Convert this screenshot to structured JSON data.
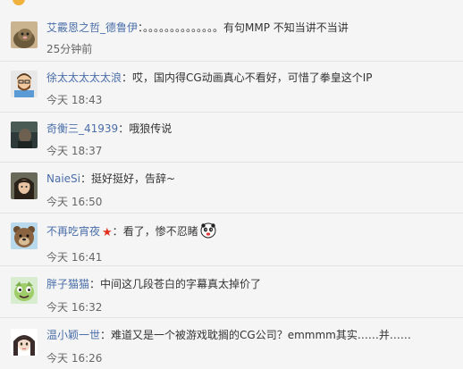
{
  "comments": [
    {
      "user": "艾霰恩之哲_德鲁伊",
      "sep": "：",
      "text": "。。。。。。。。。。。。。。有句MMP 不知当讲不当讲",
      "time": "25分钟前",
      "avatar": "mole-icon"
    },
    {
      "user": "徐太太太太太浪",
      "sep": "：",
      "text": "哎，国内得CG动画真心不看好，可惜了拳皇这个IP",
      "time": "今天 18:43",
      "avatar": "bearded-man-icon"
    },
    {
      "user": "奇衡三_41939",
      "sep": "：",
      "text": "哦狼传说",
      "time": "今天 18:37",
      "avatar": "dark-figure-icon"
    },
    {
      "user": "NaieSi",
      "sep": "：",
      "text": "挺好挺好，告辞~",
      "time": "今天 16:50",
      "avatar": "girl-portrait-icon"
    },
    {
      "user": "不再吃宵夜",
      "sep": "：",
      "text": "看了，惨不忍睹",
      "time": "今天 16:41",
      "avatar": "bear-icon",
      "badge": "★",
      "emoticon": "panda-face-icon"
    },
    {
      "user": "胖子猫猫",
      "sep": "：",
      "text": "中间这几段苍白的字幕真太掉价了",
      "time": "今天 16:32",
      "avatar": "cartoon-character-icon"
    },
    {
      "user": "温小颖一世",
      "sep": "：",
      "text": "难道又是一个被游戏耽搁的CG公司？emmmm其实……并……",
      "time": "今天 16:26",
      "avatar": "anime-girl-icon"
    }
  ]
}
